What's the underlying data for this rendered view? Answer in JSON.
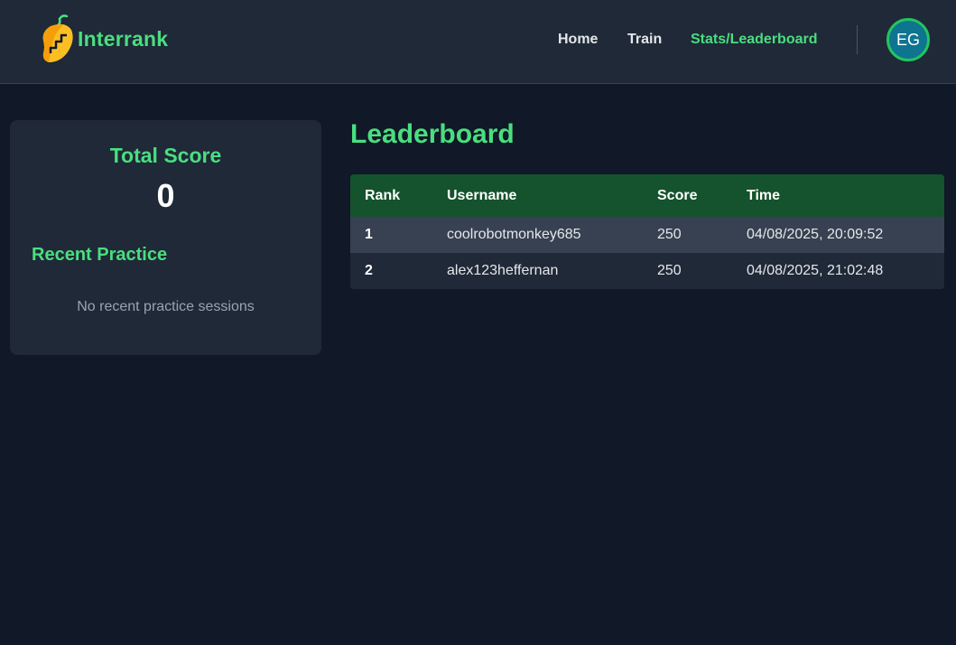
{
  "brand": {
    "name": "Interrank"
  },
  "nav": {
    "home": "Home",
    "train": "Train",
    "stats": "Stats/Leaderboard"
  },
  "user": {
    "initials": "EG"
  },
  "stats": {
    "total_score_label": "Total Score",
    "total_score": "0",
    "recent_practice_label": "Recent Practice",
    "recent_empty": "No recent practice sessions"
  },
  "leaderboard": {
    "title": "Leaderboard",
    "columns": [
      "Rank",
      "Username",
      "Score",
      "Time"
    ],
    "rows": [
      {
        "rank": "1",
        "username": "coolrobotmonkey685",
        "score": "250",
        "time": "04/08/2025, 20:09:52"
      },
      {
        "rank": "2",
        "username": "alex123heffernan",
        "score": "250",
        "time": "04/08/2025, 21:02:48"
      }
    ]
  },
  "colors": {
    "accent": "#4ade80",
    "background": "#111827",
    "panel": "#1f2937",
    "table_header": "#14532d",
    "avatar": "#0e7490"
  }
}
